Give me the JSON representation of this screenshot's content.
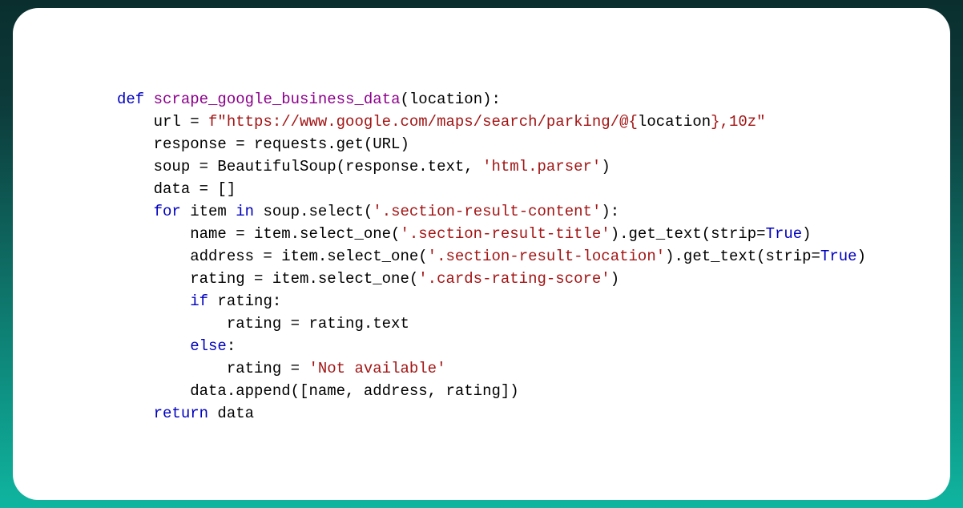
{
  "code": {
    "line1": {
      "kw": "def",
      "fn": " scrape_google_business_data",
      "rest": "(location):"
    },
    "line2": {
      "pre": "    url = ",
      "fstr_prefix": "f\"https://www.google.com/maps/search/parking/@{",
      "var": "location",
      "fstr_suffix": "},10z\""
    },
    "line3": "    response = requests.get(URL)",
    "line4": {
      "pre": "    soup = BeautifulSoup(response.text, ",
      "str": "'html.parser'",
      "post": ")"
    },
    "line5": "    data = []",
    "line6": {
      "pre": "    ",
      "kw1": "for",
      "mid1": " item ",
      "kw2": "in",
      "mid2": " soup.select(",
      "str": "'.section-result-content'",
      "post": "):"
    },
    "line7": {
      "pre": "        name = item.select_one(",
      "str": "'.section-result-title'",
      "mid": ").get_text(strip=",
      "bool": "True",
      "post": ")"
    },
    "line8": {
      "pre": "        address = item.select_one(",
      "str": "'.section-result-location'",
      "mid": ").get_text(strip=",
      "bool": "True",
      "post": ")"
    },
    "line9": {
      "pre": "        rating = item.select_one(",
      "str": "'.cards-rating-score'",
      "post": ")"
    },
    "line10": {
      "pre": "        ",
      "kw": "if",
      "post": " rating:"
    },
    "line11": "            rating = rating.text",
    "line12": {
      "pre": "        ",
      "kw": "else",
      "post": ":"
    },
    "line13": {
      "pre": "            rating = ",
      "str": "'Not available'"
    },
    "line14": "        data.append([name, address, rating])",
    "line15": {
      "pre": "    ",
      "kw": "return",
      "post": " data"
    }
  }
}
